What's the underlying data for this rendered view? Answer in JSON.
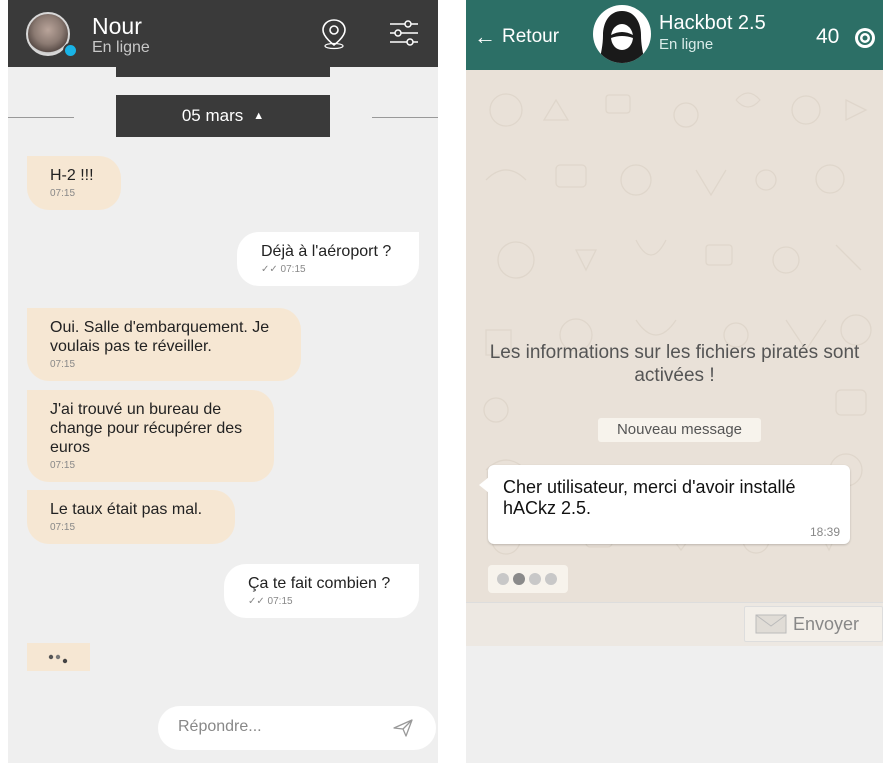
{
  "left": {
    "contact": {
      "name": "Nour",
      "status": "En ligne"
    },
    "date_separator": "05 mars",
    "messages": [
      {
        "direction": "in",
        "text": "H-2 !!!",
        "time": "07:15"
      },
      {
        "direction": "out",
        "text": "Déjà à l'aéroport ?",
        "time": "07:15"
      },
      {
        "direction": "in",
        "text": "Oui. Salle d'embarquement. Je voulais pas te réveiller.",
        "time": "07:15"
      },
      {
        "direction": "in",
        "text": "J'ai trouvé un bureau de change pour récupérer des euros",
        "time": "07:15"
      },
      {
        "direction": "in",
        "text": "Le taux était pas mal.",
        "time": "07:15"
      },
      {
        "direction": "out",
        "text": "Ça te fait combien ?",
        "time": "07:15"
      }
    ],
    "reply": {
      "placeholder": "Répondre..."
    },
    "colors": {
      "header": "#3a3a3a",
      "incoming": "#f6e7d3",
      "outgoing": "#ffffff",
      "status_dot": "#19b3e6"
    }
  },
  "right": {
    "header": {
      "back_label": "Retour",
      "bot_name": "Hackbot 2.5",
      "bot_status": "En ligne",
      "coins": "40"
    },
    "info_text": "Les informations sur les fichiers piratés sont activées !",
    "notice": "Nouveau message",
    "message": {
      "text": "Cher utilisateur, merci d'avoir installé hACkz 2.5.",
      "time": "18:39"
    },
    "send_label": "Envoyer",
    "colors": {
      "header": "#2c6f66",
      "wallpaper": "#e9e1d8"
    }
  }
}
